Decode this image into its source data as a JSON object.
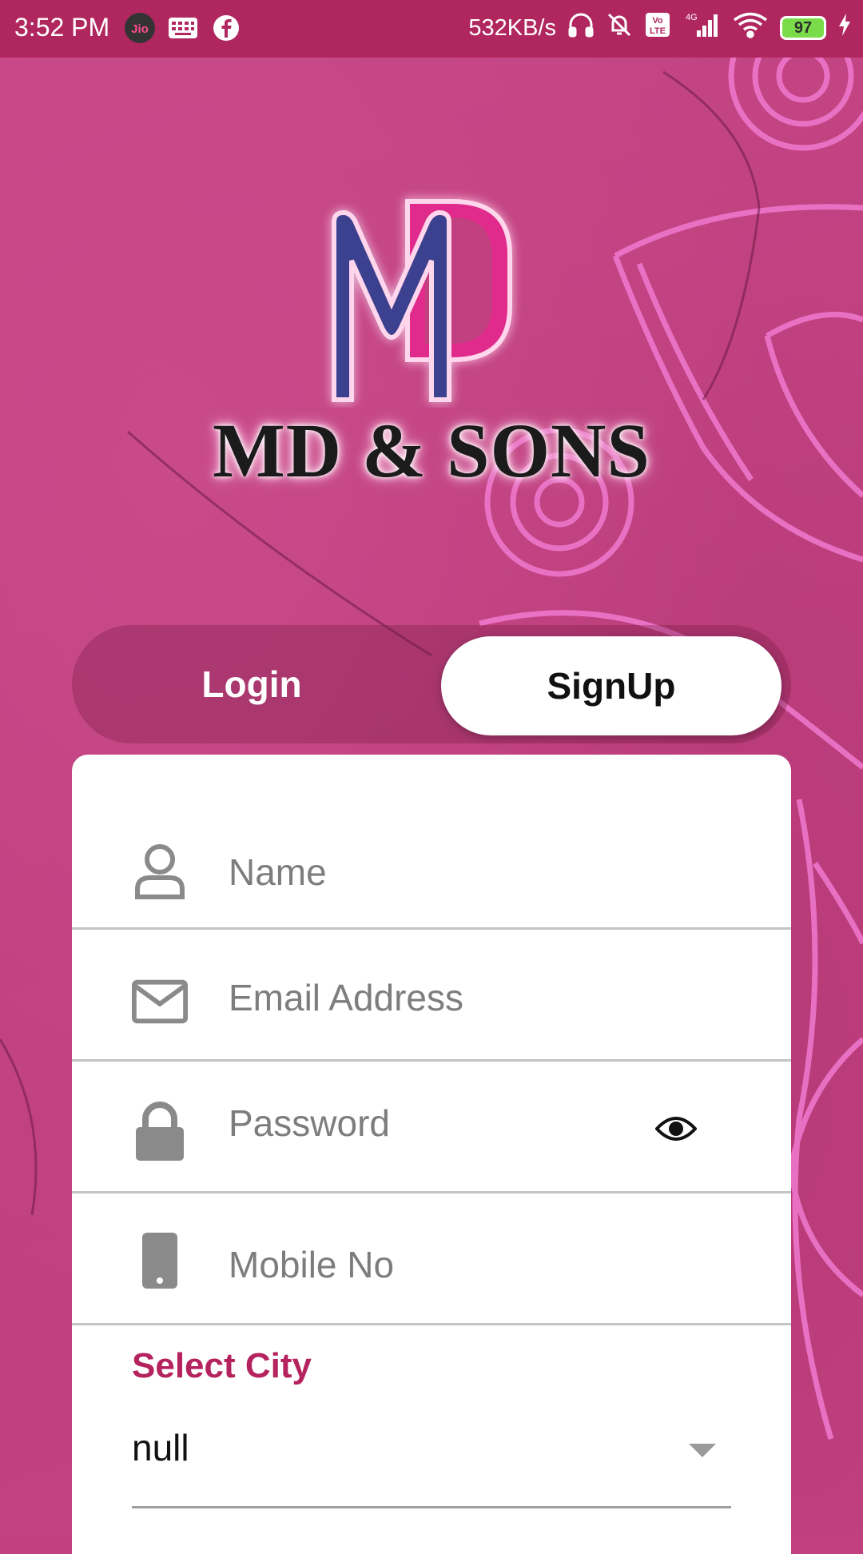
{
  "status_bar": {
    "time": "3:52 PM",
    "carrier_badge": "Jio",
    "net_speed": "532KB/s",
    "battery": "97",
    "network_type": "4G",
    "volte": "Vo LTE"
  },
  "brand": {
    "name": "MD & SONS",
    "logo_letters": "MD"
  },
  "tabs": {
    "login": "Login",
    "signup": "SignUp",
    "active": "signup"
  },
  "form": {
    "name_placeholder": "Name",
    "email_placeholder": "Email Address",
    "password_placeholder": "Password",
    "mobile_placeholder": "Mobile No",
    "city_label": "Select City",
    "city_value": "null"
  },
  "colors": {
    "status_bar": "#b0275f",
    "background": "#c2407f",
    "accent": "#b5235e",
    "logo_blue": "#3b3f8f",
    "logo_pink": "#e02a8c"
  },
  "icons": [
    "user-icon",
    "mail-icon",
    "lock-icon",
    "eye-icon",
    "phone-icon",
    "dropdown-arrow-icon"
  ]
}
